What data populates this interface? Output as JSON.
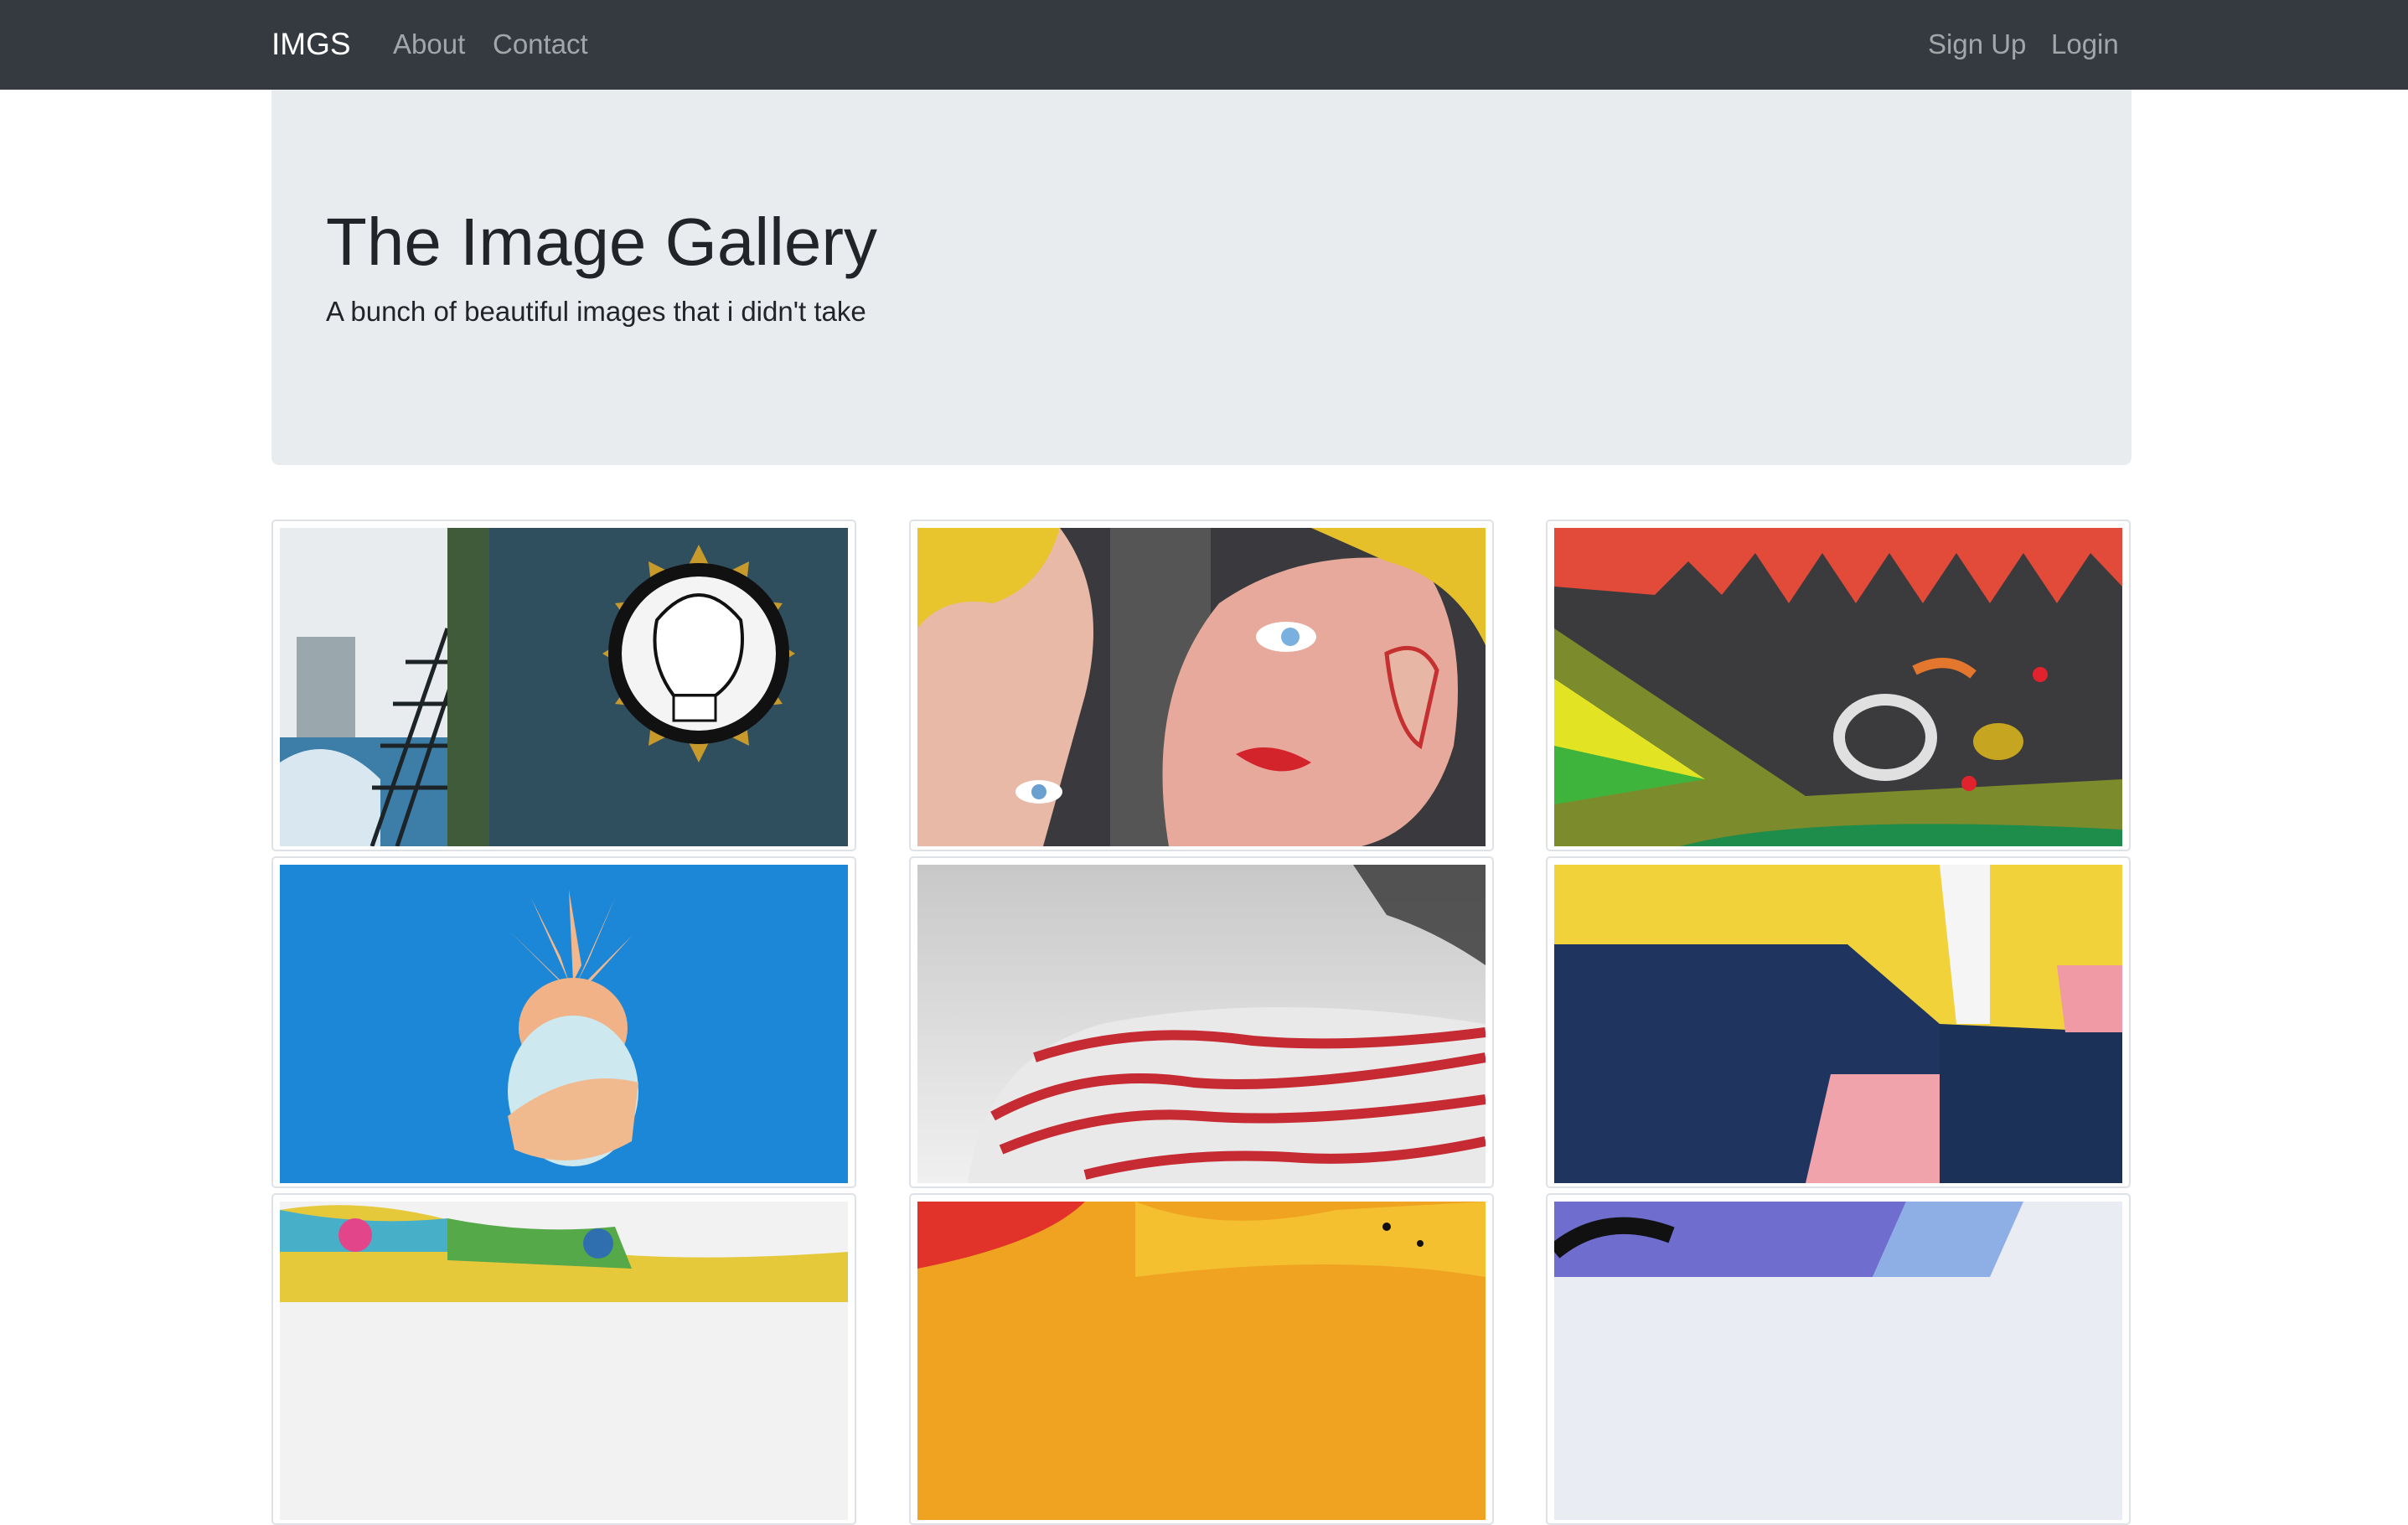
{
  "navbar": {
    "brand": "IMGS",
    "links": [
      "About",
      "Contact"
    ],
    "right_links": [
      "Sign Up",
      "Login"
    ]
  },
  "jumbotron": {
    "title": "The Image Gallery",
    "subtitle": "A bunch of beautiful images that i didn't take"
  },
  "gallery": {
    "images": [
      {
        "subject": "street mural with girl portrait and fire escape"
      },
      {
        "subject": "pop-art mural of two women faces"
      },
      {
        "subject": "colorful graffiti close-up"
      },
      {
        "subject": "pastel pineapple on blue background"
      },
      {
        "subject": "red and white striped building facade"
      },
      {
        "subject": "abstract yellow, navy and pink wall paint"
      },
      {
        "subject": "colorful graffiti wall"
      },
      {
        "subject": "orange and yellow paint strokes"
      },
      {
        "subject": "purple and blue abstract shapes"
      }
    ]
  },
  "colors": {
    "navbar_bg": "#343a40",
    "jumbotron_bg": "#e9ecef",
    "nav_link": "rgba(255,255,255,0.55)"
  }
}
